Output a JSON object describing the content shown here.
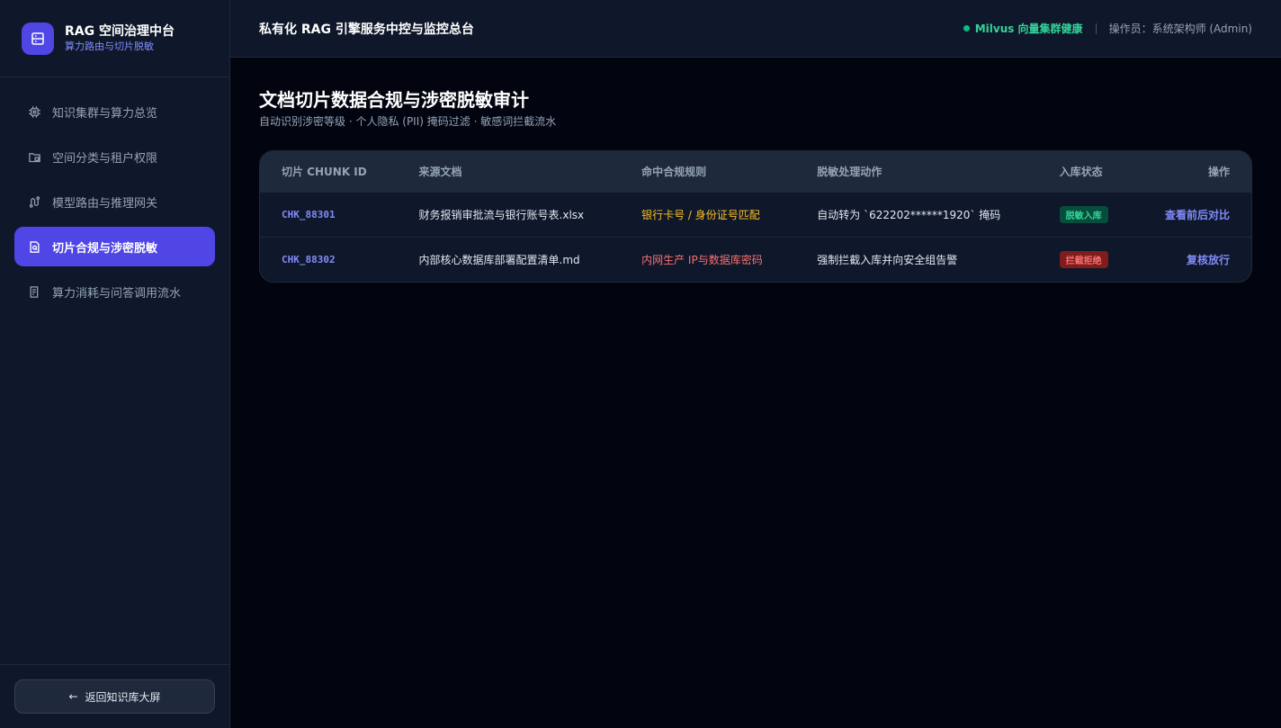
{
  "brand": {
    "title": "RAG 空间治理中台",
    "subtitle": "算力路由与切片脱敏",
    "logo_icon": "server-icon"
  },
  "sidebar": {
    "items": [
      {
        "label": "知识集群与算力总览",
        "icon": "chip-icon",
        "active": false
      },
      {
        "label": "空间分类与租户权限",
        "icon": "folder-lock-icon",
        "active": false
      },
      {
        "label": "模型路由与推理网关",
        "icon": "route-icon",
        "active": false
      },
      {
        "label": "切片合规与涉密脱敏",
        "icon": "file-shield-icon",
        "active": true
      },
      {
        "label": "算力消耗与问答调用流水",
        "icon": "receipt-icon",
        "active": false
      }
    ],
    "back_label": "返回知识库大屏",
    "back_icon": "arrow-left-icon"
  },
  "topbar": {
    "title": "私有化 RAG 引擎服务中控与监控总台",
    "status": "Milvus 向量集群健康",
    "operator": "操作员：系统架构师 (Admin)"
  },
  "page": {
    "title": "文档切片数据合规与涉密脱敏审计",
    "subtitle": "自动识别涉密等级 · 个人隐私 (PII) 掩码过滤 · 敏感词拦截流水"
  },
  "table": {
    "headers": [
      "切片 CHUNK ID",
      "来源文档",
      "命中合规规则",
      "脱敏处理动作",
      "入库状态",
      "操作"
    ],
    "rows": [
      {
        "id": "CHK_88301",
        "source": "财务报销审批流与银行账号表.xlsx",
        "rule": "银行卡号 / 身份证号匹配",
        "rule_level": "warn",
        "action": "自动转为 `622202******1920` 掩码",
        "status": "脱敏入库",
        "status_level": "ok",
        "op": "查看前后对比"
      },
      {
        "id": "CHK_88302",
        "source": "内部核心数据库部署配置清单.md",
        "rule": "内网生产 IP与数据库密码",
        "rule_level": "danger",
        "action": "强制拦截入库并向安全组告警",
        "status": "拦截拒绝",
        "status_level": "bad",
        "op": "复核放行"
      }
    ]
  },
  "colors": {
    "accent": "#4f46e5",
    "success": "#34d399",
    "warning": "#fbbf24",
    "danger": "#f87171"
  }
}
